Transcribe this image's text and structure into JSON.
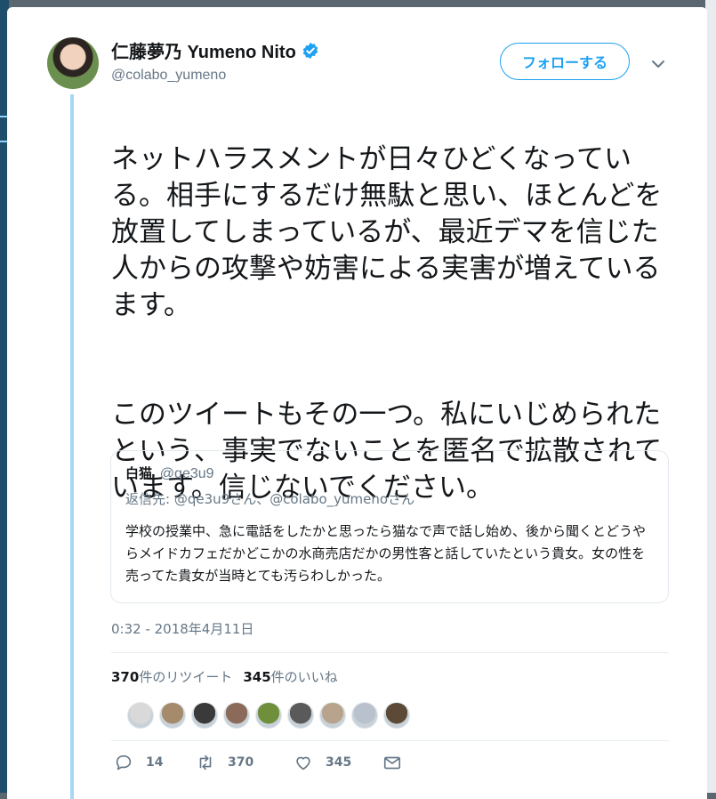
{
  "author": {
    "display_name": "仁藤夢乃 Yumeno Nito",
    "handle": "@colabo_yumeno",
    "verified_icon": "verified-badge-icon",
    "avatar_icon": "profile-photo"
  },
  "header": {
    "follow_label": "フォローする",
    "menu_icon": "chevron-down-icon"
  },
  "tweet": {
    "paragraph1": "ネットハラスメントが日々ひどくなっている。相手にするだけ無駄と思い、ほとんどを放置してしまっているが、最近デマを信じた人からの攻撃や妨害による実害が増えているます。",
    "paragraph2": "このツイートもその一つ。私にいじめられたという、事実でないことを匿名で拡散されています。信じないでください。",
    "timestamp": "0:32 - 2018年4月11日"
  },
  "quote": {
    "name": "白猫",
    "handle": "@qe3u9",
    "reply_prefix": "返信先:",
    "reply_targets": "@qe3u9さん、@colabo_yumenoさん",
    "text": "学校の授業中、急に電話をしたかと思ったら猫なで声で話し始め、後から聞くとどうやらメイドカフェだかどこかの水商売店だかの男性客と話していたという貴女。女の性を売ってた貴女が当時とても汚らわしかった。"
  },
  "stats": {
    "retweet_count": "370",
    "retweet_label": "件のリツイート",
    "like_count": "345",
    "like_label": "件のいいね"
  },
  "likers": [
    {
      "icon": "liker-avatar-1",
      "color": "#d9d9d9"
    },
    {
      "icon": "liker-avatar-2",
      "color": "#a58a6b"
    },
    {
      "icon": "liker-avatar-3",
      "color": "#3a3a3a"
    },
    {
      "icon": "liker-avatar-4",
      "color": "#8c6a5a"
    },
    {
      "icon": "liker-avatar-5",
      "color": "#6f8f3a"
    },
    {
      "icon": "liker-avatar-6",
      "color": "#5a5a5a"
    },
    {
      "icon": "liker-avatar-7",
      "color": "#b8a48c"
    },
    {
      "icon": "liker-avatar-8",
      "color": "#b9c2cc"
    },
    {
      "icon": "liker-avatar-9",
      "color": "#5d4a36"
    }
  ],
  "actions": {
    "reply_count": "14",
    "retweet_count": "370",
    "like_count": "345"
  },
  "colors": {
    "accent": "#1da1f2",
    "thread_line": "#a6d7f5",
    "secondary_text": "#657786"
  }
}
